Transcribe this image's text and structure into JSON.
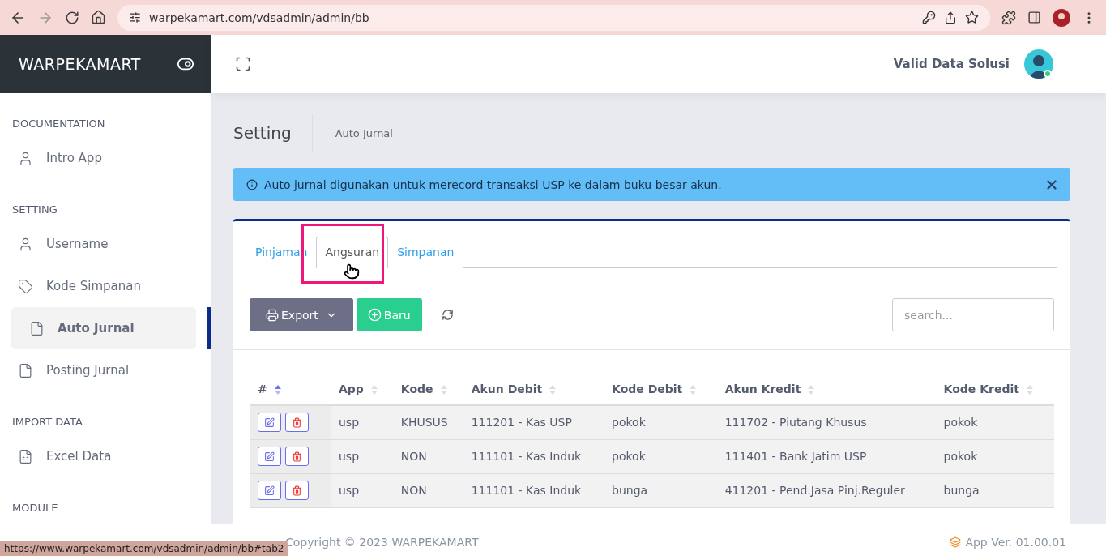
{
  "browser": {
    "url": "warpekamart.com/vdsadmin/admin/bb",
    "status_url": "https://www.warpekamart.com/vdsadmin/admin/bb#tab2"
  },
  "sidebar": {
    "brand": "WARPEKAMART",
    "sections": [
      {
        "title": "DOCUMENTATION",
        "items": [
          {
            "label": "Intro App",
            "kind": "user",
            "selected": false
          }
        ]
      },
      {
        "title": "SETTING",
        "items": [
          {
            "label": "Username",
            "kind": "user",
            "selected": false
          },
          {
            "label": "Kode Simpanan",
            "kind": "tag",
            "selected": false
          },
          {
            "label": "Auto Jurnal",
            "kind": "file",
            "selected": true
          },
          {
            "label": "Posting Jurnal",
            "kind": "file",
            "selected": false
          }
        ]
      },
      {
        "title": "IMPORT DATA",
        "items": [
          {
            "label": "Excel Data",
            "kind": "xls",
            "selected": false
          }
        ]
      },
      {
        "title": "MODULE"
      }
    ]
  },
  "header": {
    "user": "Valid Data Solusi",
    "online": true
  },
  "page": {
    "title": "Setting",
    "breadcrumb": "Auto Jurnal"
  },
  "alert": {
    "text": "Auto jurnal digunakan untuk merecord transaksi USP ke dalam buku besar akun."
  },
  "tabs": [
    {
      "label": "Pinjaman",
      "selected": false
    },
    {
      "label": "Angsuran",
      "selected": true
    },
    {
      "label": "Simpanan",
      "selected": false
    }
  ],
  "toolbar": {
    "export": "Export",
    "new": "Baru",
    "search_placeholder": "search..."
  },
  "table": {
    "columns": [
      "#",
      "App",
      "Kode",
      "Akun Debit",
      "Kode Debit",
      "Akun Kredit",
      "Kode Kredit"
    ],
    "rows": [
      [
        "",
        "usp",
        "KHUSUS",
        "111201 - Kas USP",
        "pokok",
        "111702 - Piutang Khusus",
        "pokok"
      ],
      [
        "",
        "usp",
        "NON",
        "111101 - Kas Induk",
        "pokok",
        "111401 - Bank Jatim USP",
        "pokok"
      ],
      [
        "",
        "usp",
        "NON",
        "111101 - Kas Induk",
        "bunga",
        "411201 - Pend.Jasa Pinj.Reguler",
        "bunga"
      ]
    ]
  },
  "footer": {
    "copyright": "Copyright © 2023 WARPEKAMART",
    "version": "App Ver. 01.00.01"
  }
}
